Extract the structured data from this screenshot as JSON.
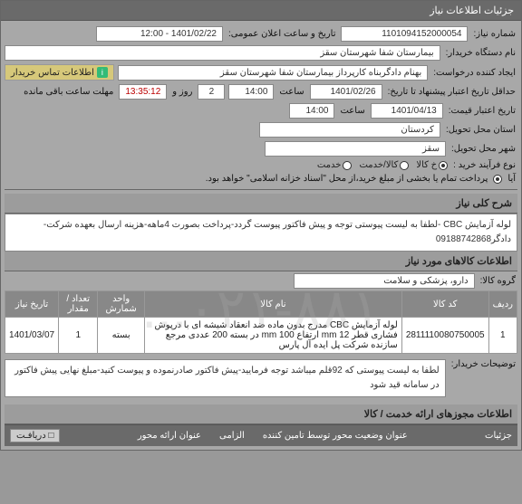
{
  "header": "جزئیات اطلاعات نیاز",
  "fields": {
    "need_no_label": "شماره نیاز:",
    "need_no": "1101094152000054",
    "announce_label": "تاریخ و ساعت اعلان عمومی:",
    "announce": "1401/02/22 - 12:00",
    "buyer_label": "نام دستگاه خریدار:",
    "buyer": "بیمارستان شفا شهرستان سقز",
    "creator_label": "ایجاد کننده درخواست:",
    "creator": "بهنام دادگربناه کارپرداز بیمارستان شفا شهرستان سقز",
    "contact_btn": "اطلاعات تماس خریدار",
    "deadline_label": "حداقل تاریخ اعتبار پیشنهاد تا تاریخ:",
    "deadline_date": "1401/02/26",
    "time_label": "ساعت",
    "deadline_time": "14:00",
    "days_label": "روز و",
    "days": "2",
    "countdown_label": "مهلت ساعت باقی مانده",
    "countdown": "13:35:12",
    "validity_label": "تاریخ اعتبار قیمت:",
    "validity_date": "1401/04/13",
    "validity_time": "14:00",
    "province_label": "استان محل تحویل:",
    "province": "کردستان",
    "city_label": "شهر محل تحویل:",
    "city": "سقز",
    "process_label": "نوع فرآیند خرید :",
    "radios": {
      "goods": "خ کالا",
      "service": "کالا/خدمت",
      "both": "خدمت"
    },
    "payment_note": "پرداخت تمام یا بخشی از مبلغ خرید،از محل \"اسناد خزانه اسلامی\" خواهد بود.",
    "payment_label": "آیا"
  },
  "sections": {
    "general_desc_title": "شرح کلی نیاز",
    "general_desc": "لوله آزمایش CBC -لطفا به لیست پیوستی توجه و پیش فاکتور پیوست گردد-پرداخت بصورت 4ماهه-هزینه ارسال بعهده شرکت-دادگر09188742868",
    "goods_title": "اطلاعات کالاهای مورد نیاز",
    "group_label": "گروه کالا:",
    "group": "دارو، پزشکی و سلامت",
    "table": {
      "headers": {
        "row": "ردیف",
        "code": "کد کالا",
        "name": "نام کالا",
        "unit": "واحد شمارش",
        "qty": "تعداد / مقدار",
        "date": "تاریخ نیاز"
      },
      "rows": [
        {
          "row": "1",
          "code": "2811110080750005",
          "name": "لوله آزمایش CBC مدرج بدون ماده ضد انعقاد شیشه ای با درپوش فشاری قطر 12 mm ارتفاع 100 mm در بسته 200 عددی مرجع سازنده شرکت پل ایده آل پارس",
          "unit": "بسته",
          "qty": "1",
          "date": "1401/03/07"
        }
      ]
    },
    "buyer_notes_label": "توضیحات خریدار:",
    "buyer_notes": "لطفا به لیست پیوستی که 92قلم میباشد توجه فرمایید-پیش فاکتور صادرنموده و پیوست کنید-مبلغ نهایی پیش فاکتور در سامانه قید شود",
    "permits_title": "اطلاعات مجوزهای ارائه خدمت / کالا"
  },
  "footer": {
    "details": "جزئیات",
    "required_label": "الزامی",
    "status_label": "عنوان وضعیت محور توسط تامین کننده",
    "axis_label": "عنوان ارائه محور",
    "toggle": "□ دریافـت"
  },
  "watermark": "۰۲۱-۸۸۱..."
}
